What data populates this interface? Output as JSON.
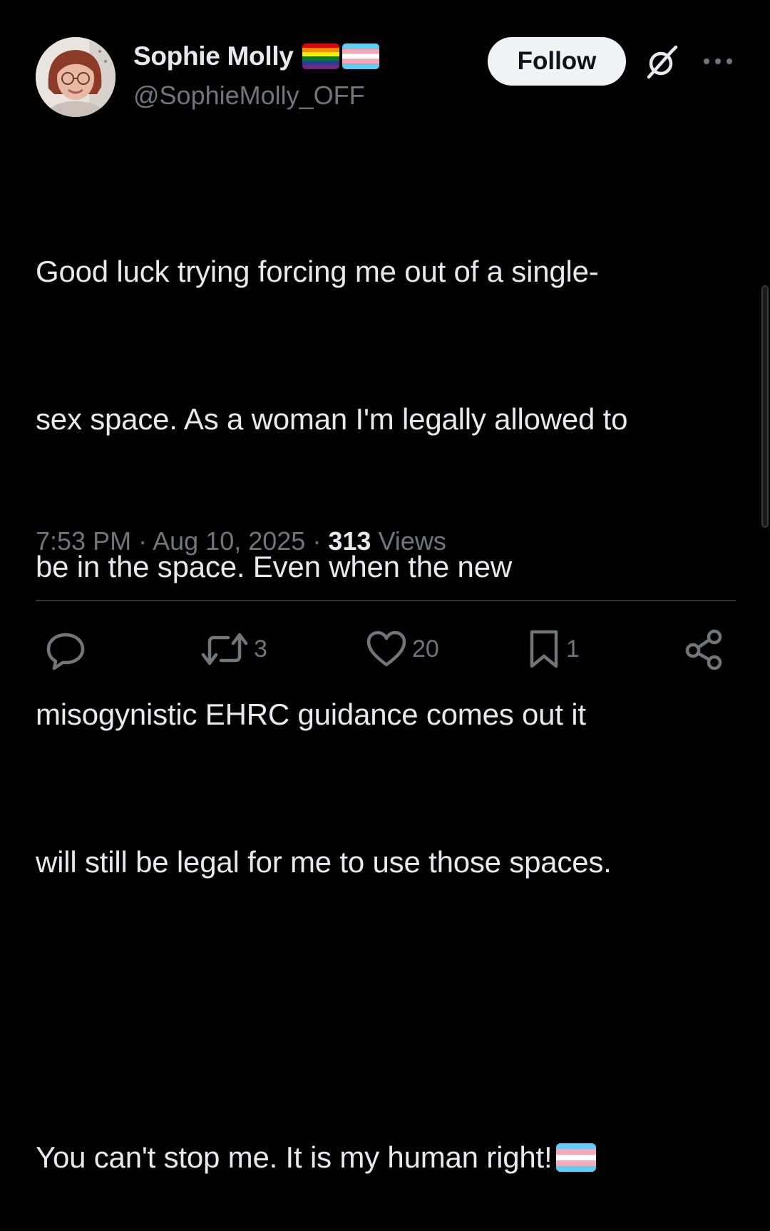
{
  "tweet": {
    "author": {
      "display_name": "Sophie Molly",
      "handle": "@SophieMolly_OFF",
      "name_flags": [
        "rainbow-flag-icon",
        "transgender-flag-icon"
      ]
    },
    "follow_label": "Follow",
    "text_lines": [
      "Good luck trying forcing me out of a single-",
      "sex space. As a woman I'm legally allowed to",
      "be in the space. Even when the new",
      "misogynistic EHRC guidance comes out it",
      "will still be legal for me to use those spaces.",
      "",
      "You can't stop me. It is my human right!"
    ],
    "meta": {
      "time": "7:53 PM",
      "separator": "·",
      "date": "Aug 10, 2025",
      "views_count": "313",
      "views_label": "Views"
    },
    "actions": {
      "reply_count": "",
      "retweet_count": "3",
      "like_count": "20",
      "bookmark_count": "1"
    }
  },
  "colors": {
    "background": "#000000",
    "text_primary": "#e7e9ea",
    "text_secondary": "#71767b",
    "divider": "#2f3336",
    "follow_bg": "#eff3f4"
  }
}
